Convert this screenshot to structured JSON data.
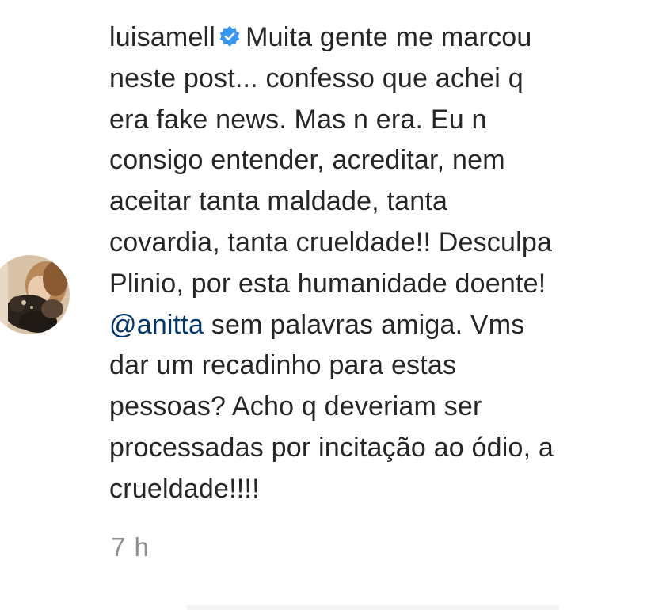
{
  "comment": {
    "username": "luisamell",
    "verified": true,
    "lines": [
      "Muita gente me marcou",
      "neste post... confesso que achei q",
      "era fake news. Mas n era. Eu n",
      "consigo entender, acreditar, nem",
      "aceitar tanta maldade, tanta",
      "covardia, tanta crueldade!! Desculpa",
      "Plinio, por esta humanidade doente!",
      "",
      "dar um recadinho para estas",
      "pessoas? Acho q deveriam ser",
      "processadas por incitação ao ódio, a",
      "crueldade!!!!"
    ],
    "mention": "@anitta",
    "mention_line_rest": "sem palavras amiga. Vms",
    "timestamp": "7 h"
  },
  "colors": {
    "text": "#262626",
    "mention": "#00376b",
    "muted": "#8e8e8e",
    "verified_badge": "#3897f0"
  },
  "icons": {
    "verified": "verified-badge-icon"
  }
}
